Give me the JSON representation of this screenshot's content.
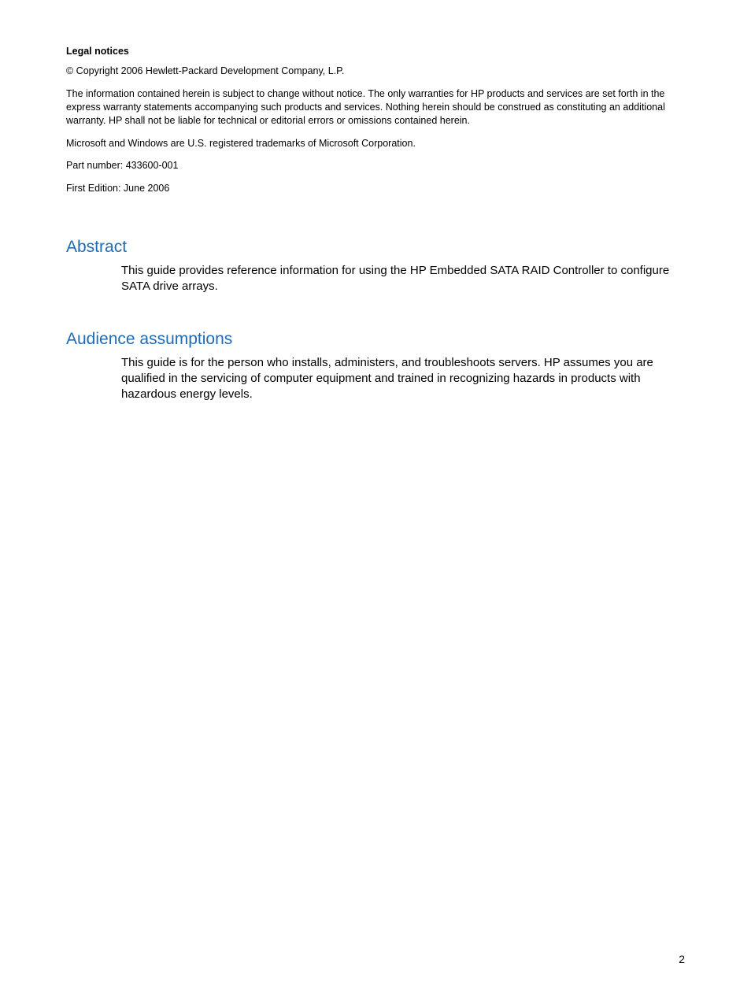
{
  "legal": {
    "heading": "Legal notices",
    "copyright": "© Copyright 2006 Hewlett-Packard Development Company, L.P.",
    "warranty": "The information contained herein is subject to change without notice. The only warranties for HP products and services are set forth in the express warranty statements accompanying such products and services. Nothing herein should be construed as constituting an additional warranty. HP shall not be liable for technical or editorial errors or omissions contained herein.",
    "trademarks": "Microsoft and Windows are U.S. registered trademarks of Microsoft Corporation.",
    "part_number": "Part number: 433600-001",
    "edition": "First Edition: June 2006"
  },
  "sections": {
    "abstract": {
      "heading": "Abstract",
      "body": "This guide provides reference information for using the HP Embedded SATA RAID Controller to configure SATA drive arrays."
    },
    "audience": {
      "heading": "Audience assumptions",
      "body": "This guide is for the person who installs, administers, and troubleshoots servers. HP assumes you are qualified in the servicing of computer equipment and trained in recognizing hazards in products with hazardous energy levels."
    }
  },
  "page_number": "2"
}
